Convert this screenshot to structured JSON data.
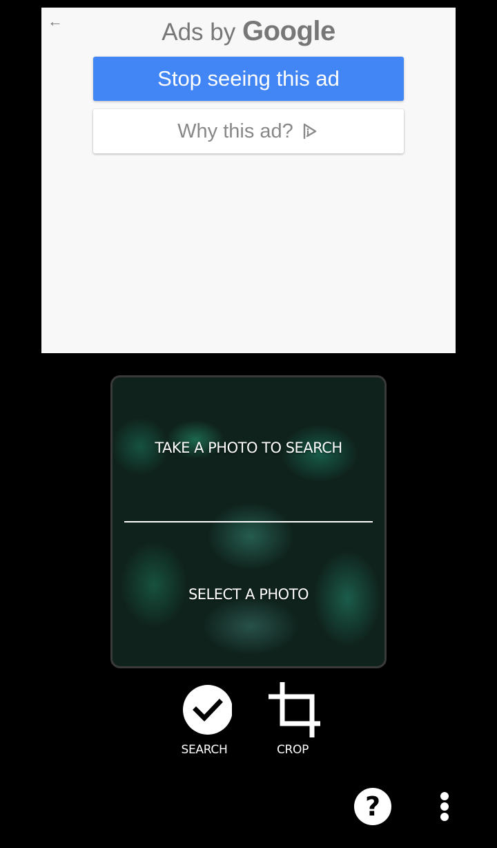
{
  "ad": {
    "back_icon": "arrow-left-icon",
    "title_prefix": "Ads by",
    "title_brand": "Google",
    "stop_button_label": "Stop seeing this ad",
    "why_button_label": "Why this ad?",
    "why_icon": "adchoices-icon",
    "colors": {
      "primary": "#4285f4",
      "panel": "#f8f8f8",
      "text_muted": "#777777"
    }
  },
  "photo_card": {
    "take_photo_label": "TAKE A PHOTO TO SEARCH",
    "select_photo_label": "SELECT A PHOTO"
  },
  "tools": {
    "search": {
      "label": "SEARCH",
      "icon": "check-circle-icon"
    },
    "crop": {
      "label": "CROP",
      "icon": "crop-icon"
    }
  },
  "footer": {
    "help_glyph": "?",
    "help_icon": "help-circle-icon",
    "more_icon": "more-vertical-icon"
  }
}
